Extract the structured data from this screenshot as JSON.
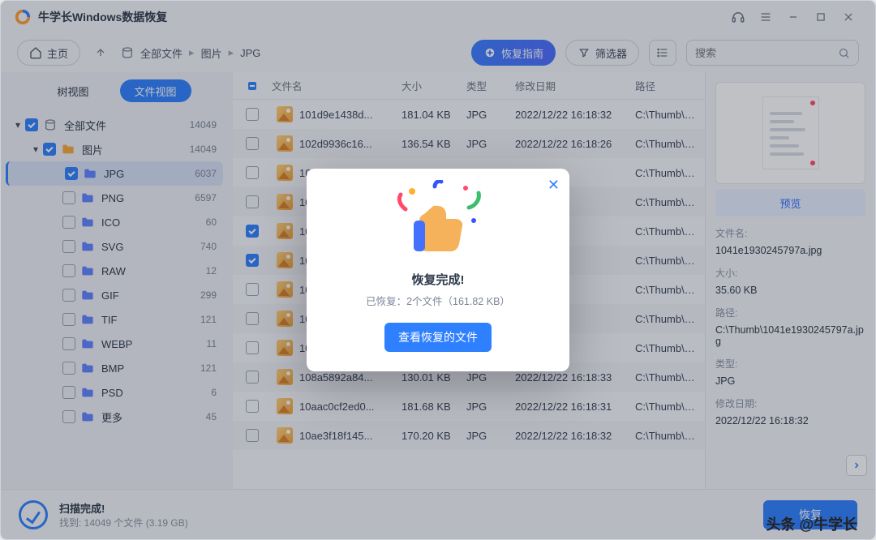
{
  "app": {
    "title": "牛学长Windows数据恢复"
  },
  "toolbar": {
    "home": "主页",
    "guide": "恢复指南",
    "filter": "筛选器",
    "search_placeholder": "搜索"
  },
  "breadcrumbs": [
    "全部文件",
    "图片",
    "JPG"
  ],
  "sidebar": {
    "view_tree": "树视图",
    "view_file": "文件视图",
    "items": [
      {
        "depth": 0,
        "label": "全部文件",
        "count": "14049",
        "expanded": true,
        "checked": true,
        "icon": "disk"
      },
      {
        "depth": 1,
        "label": "图片",
        "count": "14049",
        "expanded": true,
        "checked": true,
        "icon": "folder-orange"
      },
      {
        "depth": 2,
        "label": "JPG",
        "count": "6037",
        "selected": true,
        "checked": true
      },
      {
        "depth": 2,
        "label": "PNG",
        "count": "6597"
      },
      {
        "depth": 2,
        "label": "ICO",
        "count": "60"
      },
      {
        "depth": 2,
        "label": "SVG",
        "count": "740"
      },
      {
        "depth": 2,
        "label": "RAW",
        "count": "12"
      },
      {
        "depth": 2,
        "label": "GIF",
        "count": "299"
      },
      {
        "depth": 2,
        "label": "TIF",
        "count": "121"
      },
      {
        "depth": 2,
        "label": "WEBP",
        "count": "11"
      },
      {
        "depth": 2,
        "label": "BMP",
        "count": "121"
      },
      {
        "depth": 2,
        "label": "PSD",
        "count": "6"
      },
      {
        "depth": 2,
        "label": "更多",
        "count": "45"
      }
    ]
  },
  "columns": {
    "name": "文件名",
    "size": "大小",
    "type": "类型",
    "date": "修改日期",
    "path": "路径"
  },
  "rows": [
    {
      "name": "101d9e1438d...",
      "size": "181.04 KB",
      "type": "JPG",
      "date": "2022/12/22 16:18:32",
      "path": "C:\\Thumb\\101d..."
    },
    {
      "name": "102d9936c16...",
      "size": "136.54 KB",
      "type": "JPG",
      "date": "2022/12/22 16:18:26",
      "path": "C:\\Thumb\\102d..."
    },
    {
      "name": "1031",
      "size": "",
      "type": "",
      "date": "26",
      "path": "C:\\Thumb\\1031..."
    },
    {
      "name": "103f",
      "size": "",
      "type": "",
      "date": "32",
      "path": "C:\\Thumb\\103f4..."
    },
    {
      "name": "1040",
      "size": "",
      "type": "",
      "date": "31",
      "path": "C:\\Thumb\\1040...",
      "checked": true
    },
    {
      "name": "1041",
      "size": "",
      "type": "",
      "date": "32",
      "path": "C:\\Thumb\\1041...",
      "checked": true
    },
    {
      "name": "1047",
      "size": "",
      "type": "",
      "date": "27",
      "path": "C:\\Thumb\\1047..."
    },
    {
      "name": "1064",
      "size": "",
      "type": "",
      "date": "29",
      "path": "C:\\Thumb\\1064..."
    },
    {
      "name": "1078",
      "size": "",
      "type": "",
      "date": "27",
      "path": "C:\\Thumb\\1078..."
    },
    {
      "name": "108a5892a84...",
      "size": "130.01 KB",
      "type": "JPG",
      "date": "2022/12/22 16:18:33",
      "path": "C:\\Thumb\\108a..."
    },
    {
      "name": "10aac0cf2ed0...",
      "size": "181.68 KB",
      "type": "JPG",
      "date": "2022/12/22 16:18:31",
      "path": "C:\\Thumb\\10aac..."
    },
    {
      "name": "10ae3f18f145...",
      "size": "170.20 KB",
      "type": "JPG",
      "date": "2022/12/22 16:18:32",
      "path": "C:\\Thumb\\10ae3..."
    }
  ],
  "details": {
    "preview_btn": "预览",
    "labels": {
      "name": "文件名:",
      "size": "大小:",
      "path": "路径:",
      "type": "类型:",
      "date": "修改日期:"
    },
    "name": "1041e1930245797a.jpg",
    "size": "35.60 KB",
    "path": "C:\\Thumb\\1041e1930245797a.jpg",
    "type": "JPG",
    "date": "2022/12/22 16:18:32"
  },
  "footer": {
    "title": "扫描完成!",
    "sub": "找到: 14049 个文件 (3.19 GB)",
    "recover": "恢复"
  },
  "modal": {
    "title": "恢复完成!",
    "sub": "已恢复：2个文件（161.82 KB）",
    "btn": "查看恢复的文件"
  },
  "watermark": "头条 @牛学长"
}
